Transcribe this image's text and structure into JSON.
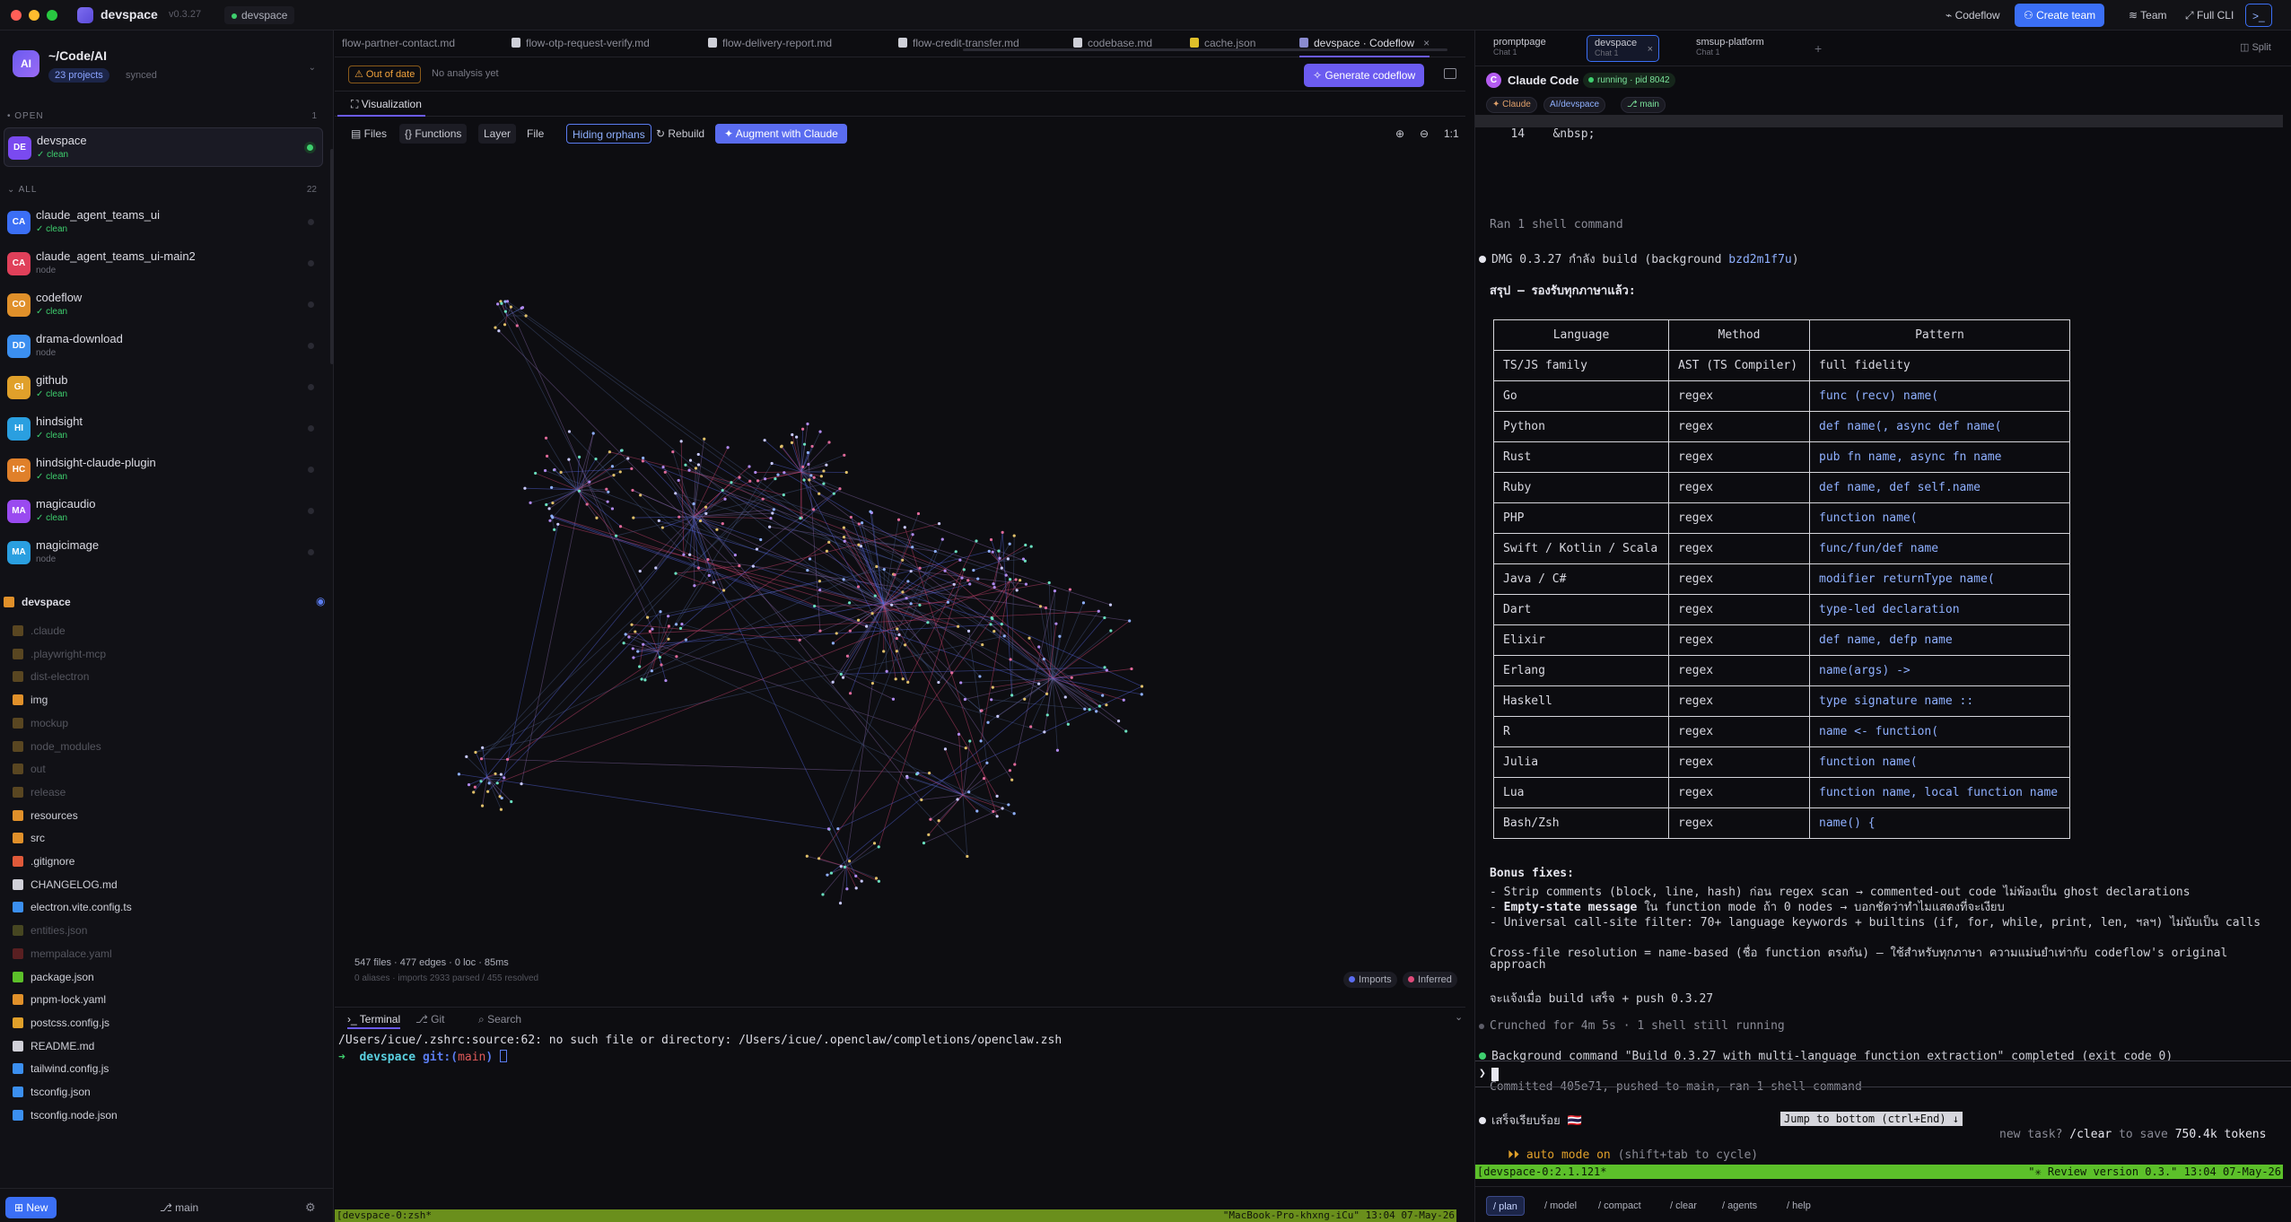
{
  "titlebar": {
    "app_name": "devspace",
    "version": "v0.3.27",
    "workspace": "devspace",
    "buttons": {
      "codeflow": "Codeflow",
      "create_team": "Create team",
      "team": "Team",
      "full_cli": "Full CLI",
      "terminal_icon": ">_"
    }
  },
  "sidebar": {
    "avatar": "AI",
    "path": "~/Code/AI",
    "project_count": "23 projects",
    "sync": "synced",
    "open_label": "OPEN",
    "open_count": "1",
    "all_label": "ALL",
    "all_count": "22",
    "open_projects": [
      {
        "initials": "DE",
        "name": "devspace",
        "status": "✓ clean",
        "color": "#7a4af0"
      }
    ],
    "projects": [
      {
        "initials": "CA",
        "name": "claude_agent_teams_ui",
        "status": "✓ clean",
        "color": "#3b6ff5"
      },
      {
        "initials": "CA",
        "name": "claude_agent_teams_ui-main2",
        "status": "node",
        "color": "#e0405a"
      },
      {
        "initials": "CO",
        "name": "codeflow",
        "status": "✓ clean",
        "color": "#e0902a"
      },
      {
        "initials": "DD",
        "name": "drama-download",
        "status": "node",
        "color": "#3b8ff0"
      },
      {
        "initials": "GI",
        "name": "github",
        "status": "✓ clean",
        "color": "#e0a02a"
      },
      {
        "initials": "HI",
        "name": "hindsight",
        "status": "✓ clean",
        "color": "#2a9fe0"
      },
      {
        "initials": "HC",
        "name": "hindsight-claude-plugin",
        "status": "✓ clean",
        "color": "#e0802a"
      },
      {
        "initials": "MA",
        "name": "magicaudio",
        "status": "✓ clean",
        "color": "#9a4af0"
      },
      {
        "initials": "MA",
        "name": "magicimage",
        "status": "node",
        "color": "#2a9fe0"
      }
    ],
    "files_title": "devspace",
    "files": [
      {
        "name": ".claude",
        "dim": true,
        "color": "#8a6a2a"
      },
      {
        "name": ".playwright-mcp",
        "dim": true,
        "color": "#8a6a2a"
      },
      {
        "name": "dist-electron",
        "dim": true,
        "color": "#8a6a2a"
      },
      {
        "name": "img",
        "dim": false,
        "color": "#e0902a"
      },
      {
        "name": "mockup",
        "dim": true,
        "color": "#8a6a2a"
      },
      {
        "name": "node_modules",
        "dim": true,
        "color": "#8a6a2a"
      },
      {
        "name": "out",
        "dim": true,
        "color": "#8a6a2a"
      },
      {
        "name": "release",
        "dim": true,
        "color": "#8a6a2a"
      },
      {
        "name": "resources",
        "dim": false,
        "color": "#e0902a"
      },
      {
        "name": "src",
        "dim": false,
        "color": "#e0902a"
      },
      {
        "name": ".gitignore",
        "dim": false,
        "color": "#e05a3a"
      },
      {
        "name": "CHANGELOG.md",
        "dim": false,
        "color": "#d0d0d8"
      },
      {
        "name": "electron.vite.config.ts",
        "dim": false,
        "color": "#3b8ff0"
      },
      {
        "name": "entities.json",
        "dim": true,
        "color": "#6a6a2a"
      },
      {
        "name": "mempalace.yaml",
        "dim": true,
        "color": "#8a2a2a"
      },
      {
        "name": "package.json",
        "dim": false,
        "color": "#5cc02a"
      },
      {
        "name": "pnpm-lock.yaml",
        "dim": false,
        "color": "#e0902a"
      },
      {
        "name": "postcss.config.js",
        "dim": false,
        "color": "#e0a02a"
      },
      {
        "name": "README.md",
        "dim": false,
        "color": "#d0d0d8"
      },
      {
        "name": "tailwind.config.js",
        "dim": false,
        "color": "#3b8ff0"
      },
      {
        "name": "tsconfig.json",
        "dim": false,
        "color": "#3b8ff0"
      },
      {
        "name": "tsconfig.node.json",
        "dim": false,
        "color": "#3b8ff0"
      }
    ],
    "new_label": "New",
    "branch": "main"
  },
  "editor": {
    "tabs": [
      {
        "label": "flow-partner-contact.md",
        "active": false,
        "icon": false
      },
      {
        "label": "flow-otp-request-verify.md",
        "active": false,
        "icon": true
      },
      {
        "label": "flow-delivery-report.md",
        "active": false,
        "icon": true
      },
      {
        "label": "flow-credit-transfer.md",
        "active": false,
        "icon": true
      },
      {
        "label": "codebase.md",
        "active": false,
        "icon": true
      },
      {
        "label": "cache.json",
        "active": false,
        "icon": true
      },
      {
        "label": "devspace · Codeflow",
        "active": true,
        "icon": true
      }
    ],
    "out_of_date": "Out of date",
    "no_analysis": "No analysis yet",
    "generate": "Generate codeflow",
    "viz_tab": "Visualization",
    "graph_buttons": {
      "files": "Files",
      "functions": "Functions",
      "layer": "Layer",
      "file": "File",
      "hiding_orphans": "Hiding orphans",
      "rebuild": "Rebuild",
      "augment": "Augment with Claude",
      "zoom_in": "⊕",
      "zoom_out": "⊖",
      "ratio": "1:1"
    },
    "stats": "547 files · 477 edges · 0 loc · 85ms",
    "stats2": "0 aliases · imports 2933 parsed / 455 resolved",
    "legend_imports": "Imports",
    "legend_inferred": "Inferred",
    "terminal_tabs": {
      "terminal": "Terminal",
      "git": "Git",
      "search": "Search"
    },
    "term_line1": "/Users/icue/.zshrc:source:62: no such file or directory: /Users/icue/.openclaw/completions/openclaw.zsh",
    "term_prompt_arrow": "➜",
    "term_prompt_dir": "devspace",
    "term_prompt_git": "git:(",
    "term_prompt_branch": "main",
    "term_prompt_close": ")",
    "tmux_left": "[devspace-0:zsh*",
    "tmux_right": "\"MacBook-Pro-khxng-iCu\" 13:04 07-May-26"
  },
  "chat": {
    "tabs": [
      {
        "title": "promptpage",
        "sub": "Chat 1",
        "active": false
      },
      {
        "title": "devspace",
        "sub": "Chat 1",
        "active": true
      },
      {
        "title": "smsup-platform",
        "sub": "Chat 1",
        "active": false
      }
    ],
    "split_label": "Split",
    "cc_title": "Claude Code",
    "running": "running · pid 8042",
    "tags": {
      "claude": "✦ Claude",
      "path": "AI/devspace",
      "branch": "⎇ main"
    },
    "lines": {
      "nbsp_num": "14",
      "nbsp": "&nbsp;",
      "ran_shell": "Ran 1 shell command",
      "dmg": "DMG 0.3.27 กำลัง build (background ",
      "dmg_id": "bzd2m1f7u",
      "dmg_close": ")",
      "summary": "สรุป — รองรับทุกภาษาแล้ว:",
      "bonus_title": "Bonus fixes:",
      "bonus1": "- Strip comments (block, line, hash) ก่อน regex scan → commented-out code ไม่พ้องเป็น ghost declarations",
      "bonus2a": "- ",
      "bonus2b": "Empty-state message",
      "bonus2c": " ใน function mode ถ้า 0 nodes → บอกชัดว่าทำไมแสดงที่จะเงียบ",
      "bonus3": "- Universal call-site filter: 70+ language keywords + builtins (if, for, while, print, len, ฯลฯ) ไม่นับเป็น calls",
      "cross1": "Cross-file resolution = name-based (ชื่อ function ตรงกัน) — ใช้สำหรับทุกภาษา ความแม่นยำเท่ากับ codeflow's original",
      "cross2": "approach",
      "notify": "จะแจ้งเมื่อ build เสร็จ + push 0.3.27",
      "crunched": "Crunched for 4m 5s · 1 shell still running",
      "bg_done": "Background command \"Build 0.3.27 with multi-language function extraction\" completed (exit code 0)",
      "committed": "Committed 405e71, pushed to main, ran 1 shell command",
      "done": "เสร็จเรียบร้อย 🇹🇭",
      "jump": "Jump to bottom (ctrl+End) ↓",
      "new_task_a": "new task? ",
      "new_task_b": "/clear",
      "new_task_c": " to save ",
      "new_task_d": "750.4k tokens",
      "prompt": "❯",
      "auto_mode_a": "⏵⏵ auto mode on",
      "auto_mode_b": " (shift+tab to cycle)",
      "status_left": "[devspace-0:2.1.121*",
      "status_right": "\"✳ Review version 0.3.\" 13:04 07-May-26"
    },
    "table": {
      "headers": [
        "Language",
        "Method",
        "Pattern"
      ],
      "rows": [
        [
          "TS/JS family",
          "AST (TS Compiler)",
          "full fidelity"
        ],
        [
          "Go",
          "regex",
          "func (recv) name("
        ],
        [
          "Python",
          "regex",
          "def name(, async def name("
        ],
        [
          "Rust",
          "regex",
          "pub fn name, async fn name"
        ],
        [
          "Ruby",
          "regex",
          "def name, def self.name"
        ],
        [
          "PHP",
          "regex",
          "function name("
        ],
        [
          "Swift / Kotlin / Scala",
          "regex",
          "func/fun/def name"
        ],
        [
          "Java / C#",
          "regex",
          "modifier returnType name("
        ],
        [
          "Dart",
          "regex",
          "type-led declaration"
        ],
        [
          "Elixir",
          "regex",
          "def name, defp name"
        ],
        [
          "Erlang",
          "regex",
          "name(args) ->"
        ],
        [
          "Haskell",
          "regex",
          "type signature name ::"
        ],
        [
          "R",
          "regex",
          "name <- function("
        ],
        [
          "Julia",
          "regex",
          "function name("
        ],
        [
          "Lua",
          "regex",
          "function name, local function name"
        ],
        [
          "Bash/Zsh",
          "regex",
          "name() {"
        ]
      ]
    },
    "commands": [
      "/ plan",
      "/ model",
      "/ compact",
      "/ clear",
      "/ agents",
      "/ help"
    ]
  }
}
